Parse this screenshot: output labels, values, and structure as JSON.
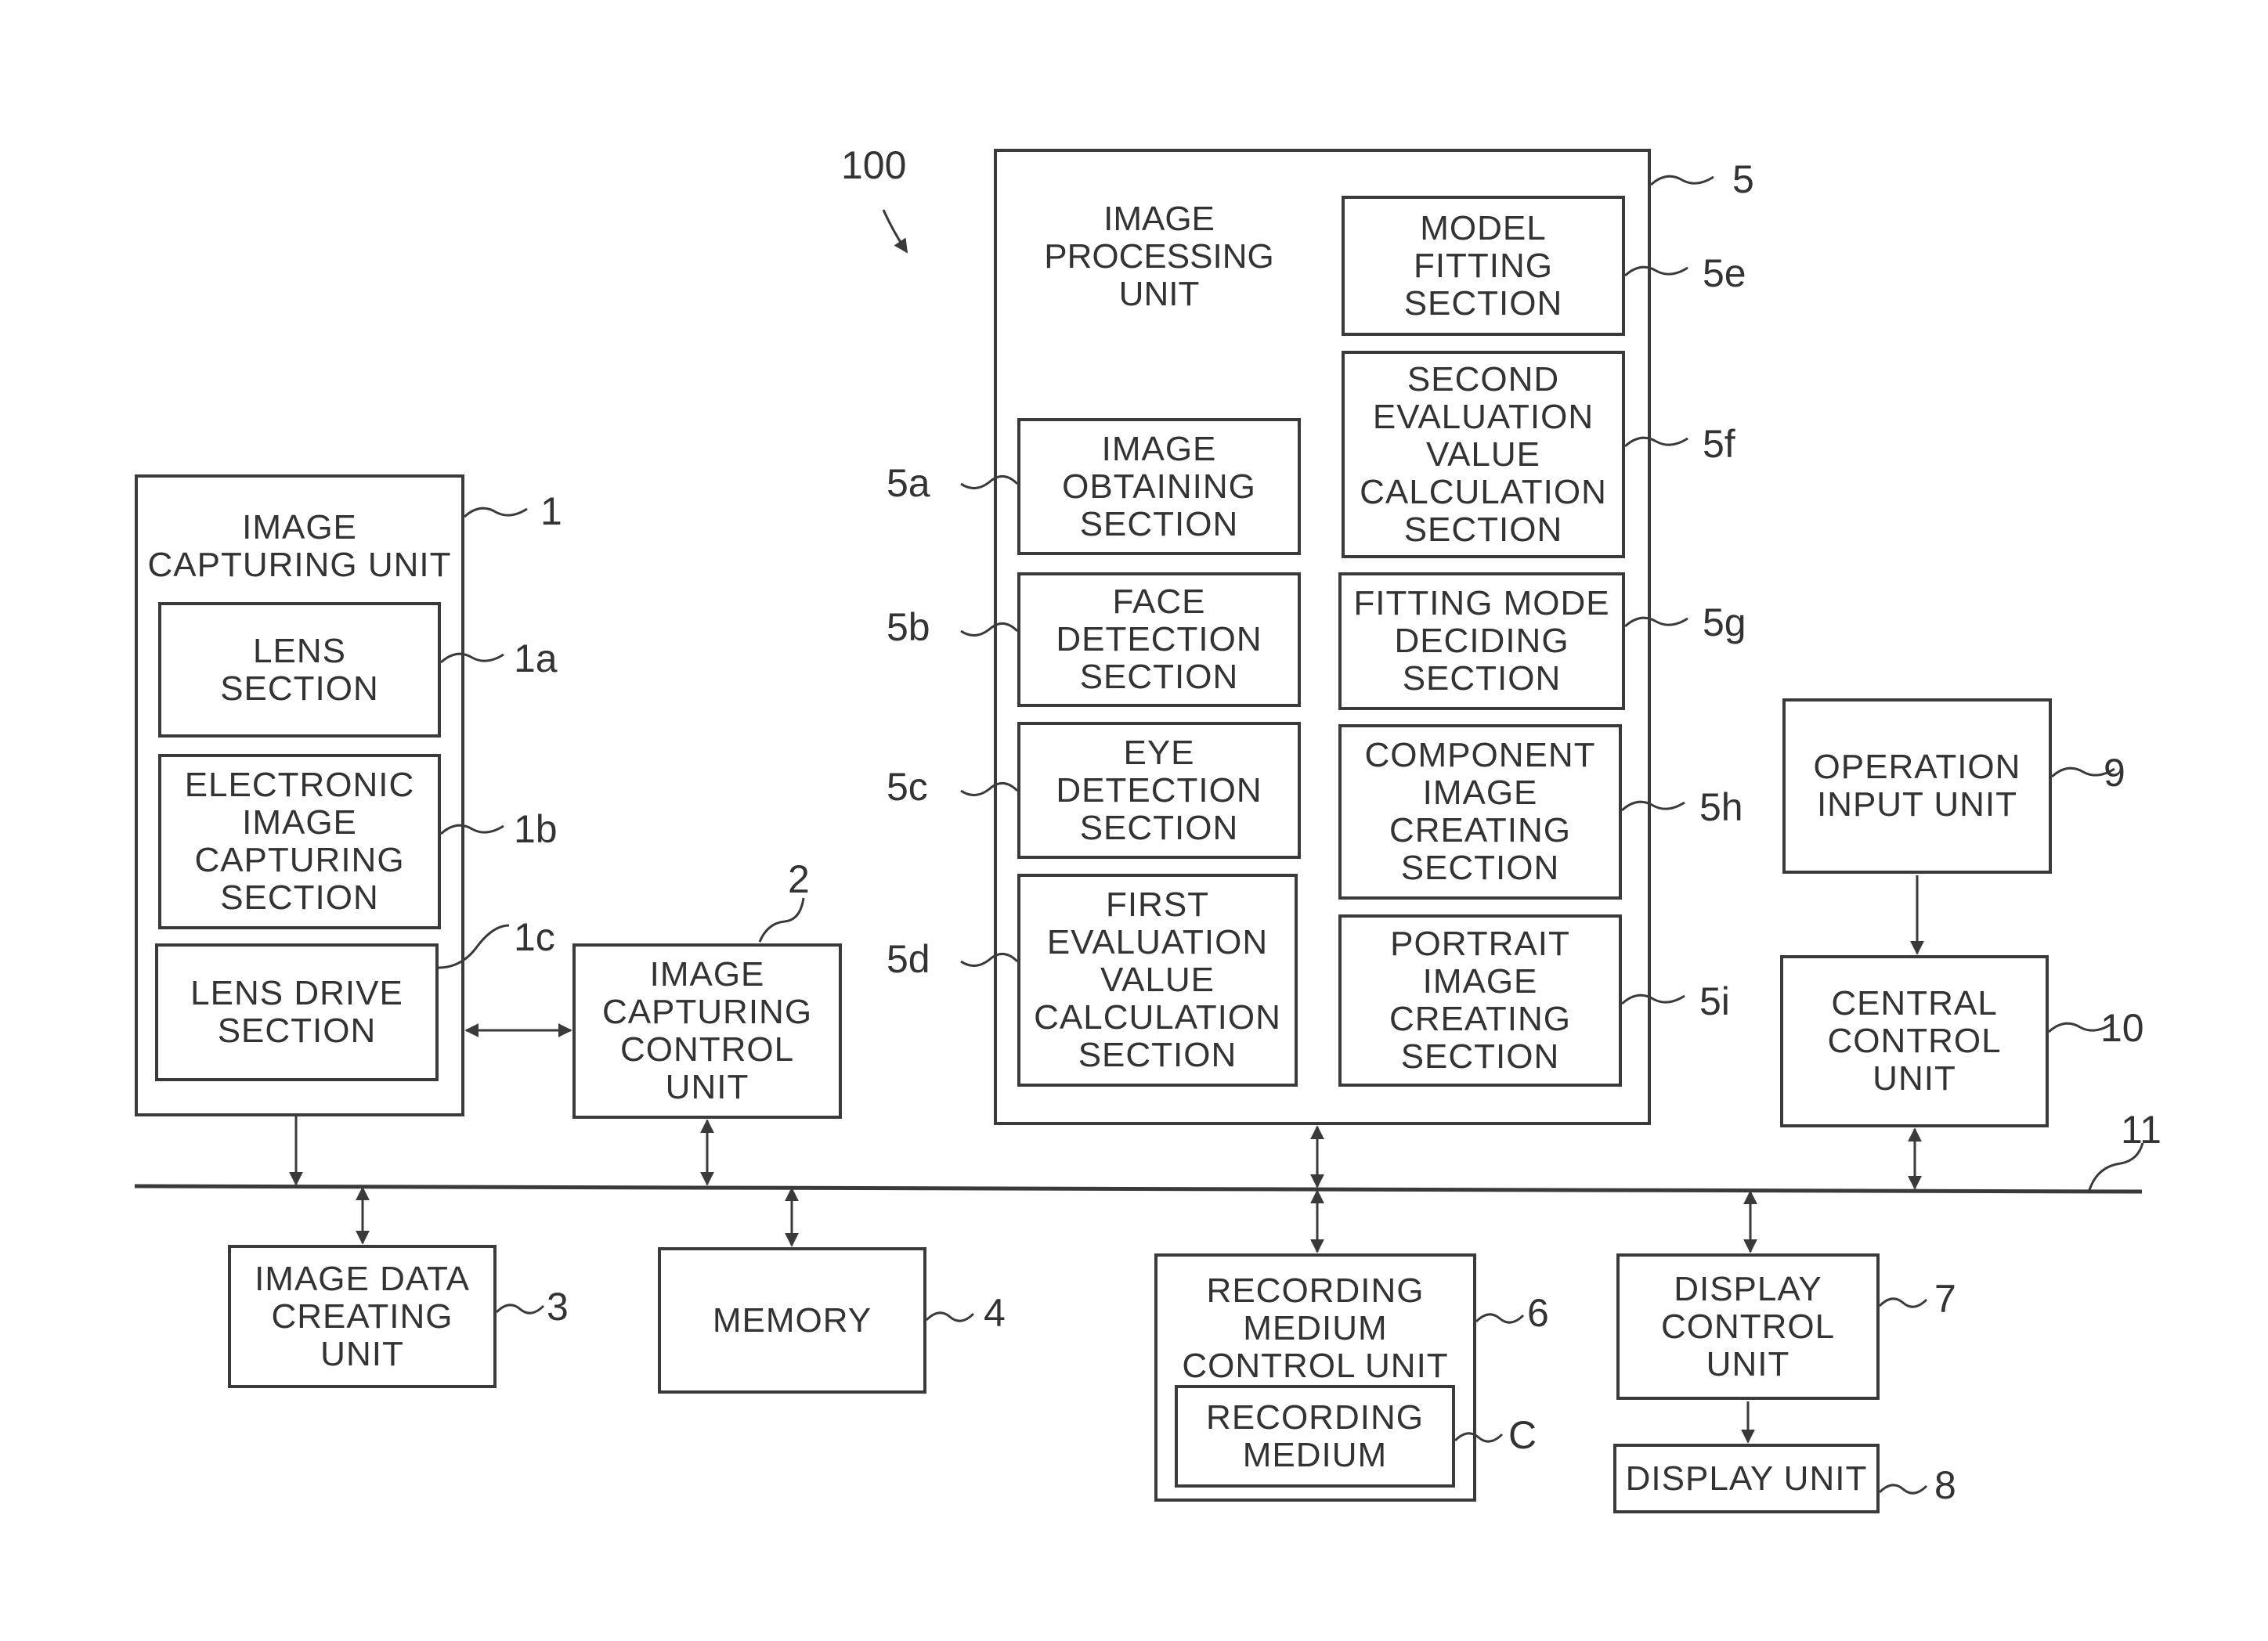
{
  "figure": {
    "system_ref": "100",
    "bus": {
      "ref": "11"
    },
    "blocks": {
      "image_capturing_unit": {
        "ref": "1",
        "label": "IMAGE\nCAPTURING UNIT"
      },
      "lens_section": {
        "ref": "1a",
        "label": "LENS\nSECTION"
      },
      "electronic_image_capturing_section": {
        "ref": "1b",
        "label": "ELECTRONIC\nIMAGE\nCAPTURING\nSECTION"
      },
      "lens_drive_section": {
        "ref": "1c",
        "label": "LENS DRIVE\nSECTION"
      },
      "image_capturing_control_unit": {
        "ref": "2",
        "label": "IMAGE\nCAPTURING\nCONTROL\nUNIT"
      },
      "image_data_creating_unit": {
        "ref": "3",
        "label": "IMAGE DATA\nCREATING\nUNIT"
      },
      "memory": {
        "ref": "4",
        "label": "MEMORY"
      },
      "image_processing_unit": {
        "ref": "5",
        "label": "IMAGE\nPROCESSING\nUNIT"
      },
      "image_obtaining_section": {
        "ref": "5a",
        "label": "IMAGE\nOBTAINING\nSECTION"
      },
      "face_detection_section": {
        "ref": "5b",
        "label": "FACE\nDETECTION\nSECTION"
      },
      "eye_detection_section": {
        "ref": "5c",
        "label": "EYE\nDETECTION\nSECTION"
      },
      "first_evaluation_value_calculation_section": {
        "ref": "5d",
        "label": "FIRST\nEVALUATION\nVALUE\nCALCULATION\nSECTION"
      },
      "model_fitting_section": {
        "ref": "5e",
        "label": "MODEL\nFITTING\nSECTION"
      },
      "second_evaluation_value_calculation_section": {
        "ref": "5f",
        "label": "SECOND\nEVALUATION\nVALUE\nCALCULATION\nSECTION"
      },
      "fitting_mode_deciding_section": {
        "ref": "5g",
        "label": "FITTING MODE\nDECIDING\nSECTION"
      },
      "component_image_creating_section": {
        "ref": "5h",
        "label": "COMPONENT\nIMAGE\nCREATING\nSECTION"
      },
      "portrait_image_creating_section": {
        "ref": "5i",
        "label": "PORTRAIT\nIMAGE\nCREATING\nSECTION"
      },
      "recording_medium_control_unit": {
        "ref": "6",
        "label": "RECORDING\nMEDIUM\nCONTROL UNIT"
      },
      "recording_medium": {
        "ref": "C",
        "label": "RECORDING\nMEDIUM"
      },
      "display_control_unit": {
        "ref": "7",
        "label": "DISPLAY\nCONTROL\nUNIT"
      },
      "display_unit": {
        "ref": "8",
        "label": "DISPLAY UNIT"
      },
      "operation_input_unit": {
        "ref": "9",
        "label": "OPERATION\nINPUT UNIT"
      },
      "central_control_unit": {
        "ref": "10",
        "label": "CENTRAL\nCONTROL\nUNIT"
      }
    },
    "connections": [
      {
        "from": "1",
        "to": "11",
        "type": "one-way"
      },
      {
        "from": "1c",
        "to": "2",
        "type": "two-way"
      },
      {
        "from": "2",
        "to": "11",
        "type": "two-way"
      },
      {
        "from": "11",
        "to": "3",
        "type": "two-way"
      },
      {
        "from": "11",
        "to": "4",
        "type": "two-way"
      },
      {
        "from": "5",
        "to": "11",
        "type": "two-way"
      },
      {
        "from": "11",
        "to": "6",
        "type": "two-way"
      },
      {
        "from": "11",
        "to": "7",
        "type": "two-way"
      },
      {
        "from": "7",
        "to": "8",
        "type": "one-way"
      },
      {
        "from": "9",
        "to": "10",
        "type": "one-way"
      },
      {
        "from": "10",
        "to": "11",
        "type": "two-way"
      }
    ]
  }
}
